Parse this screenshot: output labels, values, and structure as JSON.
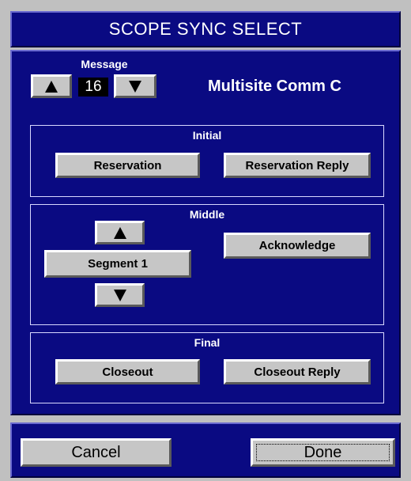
{
  "dialog": {
    "title": "SCOPE SYNC SELECT"
  },
  "message": {
    "label": "Message",
    "number": "16",
    "name": "Multisite Comm C",
    "up_icon": "arrow-up-icon",
    "down_icon": "arrow-down-icon"
  },
  "initial": {
    "label": "Initial",
    "reservation_label": "Reservation",
    "reservation_reply_label": "Reservation Reply"
  },
  "middle": {
    "label": "Middle",
    "segment_label": "Segment  1",
    "acknowledge_label": "Acknowledge"
  },
  "final": {
    "label": "Final",
    "closeout_label": "Closeout",
    "closeout_reply_label": "Closeout Reply"
  },
  "footer": {
    "cancel_label": "Cancel",
    "done_label": "Done"
  },
  "colors": {
    "panel_bg": "#0a0a82",
    "window_bg": "#c0c0c0",
    "button_face": "#c6c6c6"
  }
}
